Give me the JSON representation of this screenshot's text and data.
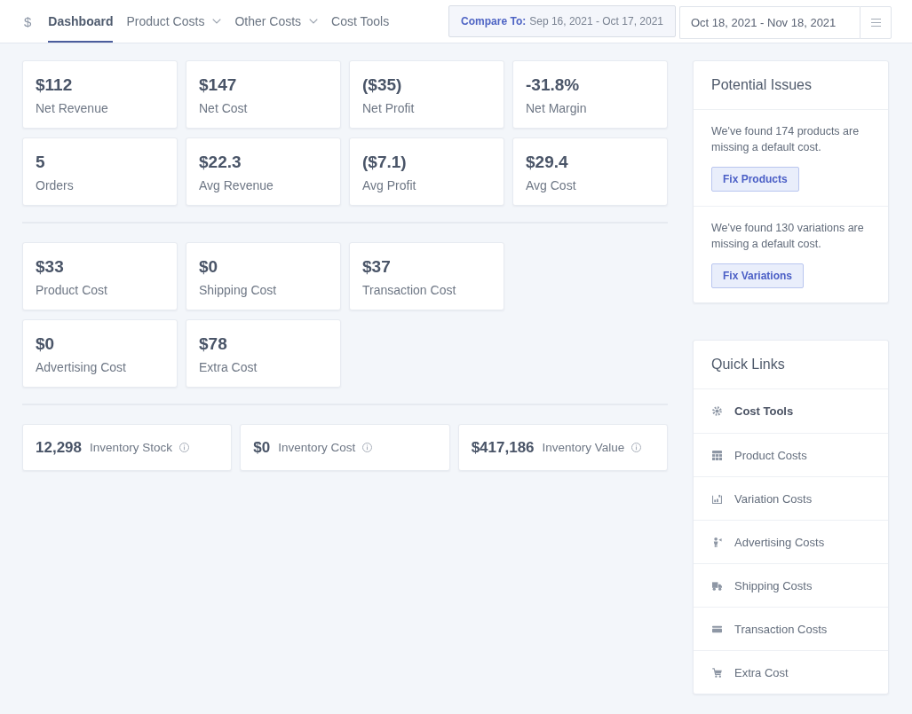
{
  "nav": {
    "logo": "$",
    "items": [
      {
        "label": "Dashboard",
        "selected": true,
        "dropdown": false
      },
      {
        "label": "Product Costs",
        "selected": false,
        "dropdown": true
      },
      {
        "label": "Other Costs",
        "selected": false,
        "dropdown": true
      },
      {
        "label": "Cost Tools",
        "selected": false,
        "dropdown": false
      }
    ]
  },
  "compare": {
    "label": "Compare To:",
    "range": "Sep 16, 2021 - Oct 17, 2021"
  },
  "date_range": {
    "value": "Oct 18, 2021 - Nov 18, 2021"
  },
  "stat_groups": [
    {
      "rows": [
        [
          {
            "value": "$112",
            "label": "Net Revenue"
          },
          {
            "value": "$147",
            "label": "Net Cost"
          },
          {
            "value": "($35)",
            "label": "Net Profit"
          },
          {
            "value": "-31.8%",
            "label": "Net Margin"
          }
        ],
        [
          {
            "value": "5",
            "label": "Orders"
          },
          {
            "value": "$22.3",
            "label": "Avg Revenue"
          },
          {
            "value": "($7.1)",
            "label": "Avg Profit"
          },
          {
            "value": "$29.4",
            "label": "Avg Cost"
          }
        ]
      ]
    },
    {
      "rows": [
        [
          {
            "value": "$33",
            "label": "Product Cost"
          },
          {
            "value": "$0",
            "label": "Shipping Cost"
          },
          {
            "value": "$37",
            "label": "Transaction Cost"
          }
        ],
        [
          {
            "value": "$0",
            "label": "Advertising Cost"
          },
          {
            "value": "$78",
            "label": "Extra Cost"
          }
        ]
      ]
    }
  ],
  "inventory": [
    {
      "value": "12,298",
      "label": "Inventory Stock"
    },
    {
      "value": "$0",
      "label": "Inventory Cost"
    },
    {
      "value": "$417,186",
      "label": "Inventory Value"
    }
  ],
  "potential_issues": {
    "title": "Potential Issues",
    "issues": [
      {
        "text": "We've found 174 products are missing a default cost.",
        "button": "Fix Products"
      },
      {
        "text": "We've found 130 variations are missing a default cost.",
        "button": "Fix Variations"
      }
    ]
  },
  "quick_links": {
    "title": "Quick Links",
    "items": [
      {
        "label": "Cost Tools",
        "kind": "gear",
        "selected": true
      },
      {
        "label": "Product Costs",
        "kind": "table",
        "selected": false
      },
      {
        "label": "Variation Costs",
        "kind": "chart",
        "selected": false
      },
      {
        "label": "Advertising Costs",
        "kind": "person",
        "selected": false
      },
      {
        "label": "Shipping Costs",
        "kind": "truck",
        "selected": false
      },
      {
        "label": "Transaction Costs",
        "kind": "card",
        "selected": false
      },
      {
        "label": "Extra Cost",
        "kind": "cart",
        "selected": false
      }
    ]
  }
}
